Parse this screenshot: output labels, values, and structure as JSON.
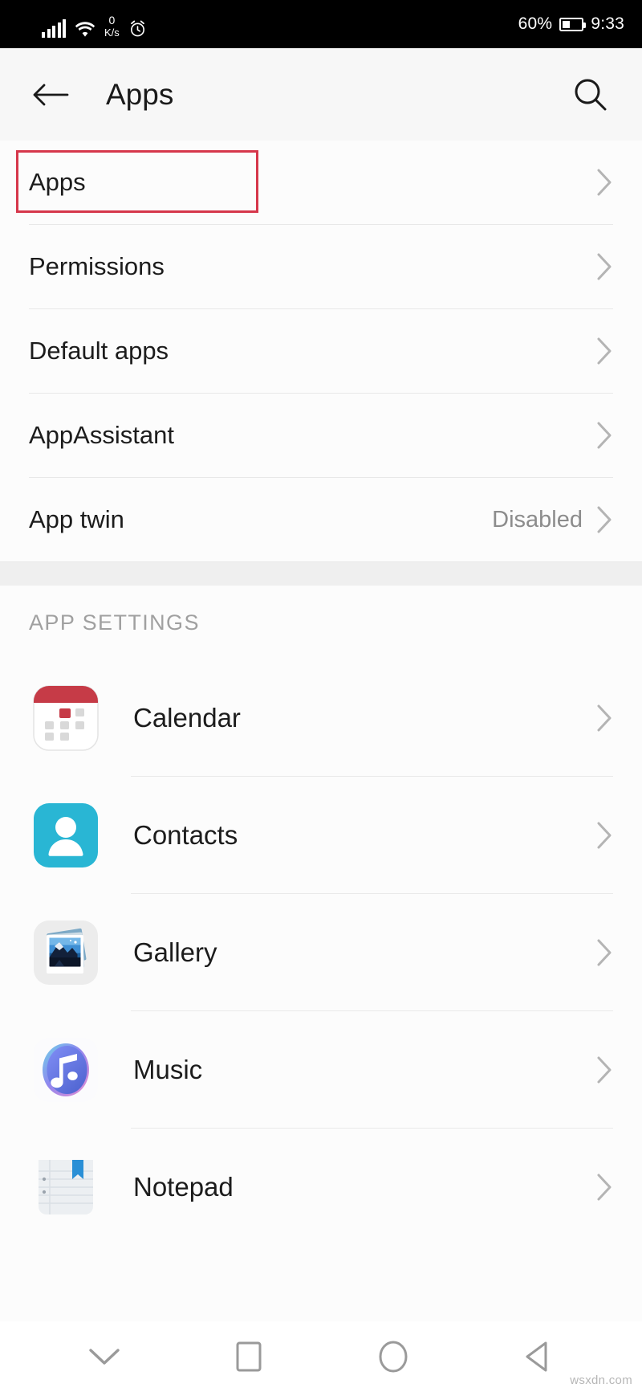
{
  "statusbar": {
    "network_speed_value": "0",
    "network_speed_unit": "K/s",
    "battery_percent": "60%",
    "time": "9:33",
    "icons": [
      "signal-bars-icon",
      "wifi-icon",
      "alarm-clock-icon",
      "battery-icon"
    ]
  },
  "appbar": {
    "back_label": "back-arrow-icon",
    "title": "Apps",
    "search_label": "search-icon"
  },
  "settings_list": [
    {
      "label": "Apps",
      "value": "",
      "highlighted": true
    },
    {
      "label": "Permissions",
      "value": "",
      "highlighted": false
    },
    {
      "label": "Default apps",
      "value": "",
      "highlighted": false
    },
    {
      "label": "AppAssistant",
      "value": "",
      "highlighted": false
    },
    {
      "label": "App twin",
      "value": "Disabled",
      "highlighted": false
    }
  ],
  "app_settings": {
    "header": "APP SETTINGS",
    "apps": [
      {
        "name": "Calendar",
        "icon": "calendar-app-icon"
      },
      {
        "name": "Contacts",
        "icon": "contacts-app-icon"
      },
      {
        "name": "Gallery",
        "icon": "gallery-app-icon"
      },
      {
        "name": "Music",
        "icon": "music-app-icon"
      },
      {
        "name": "Notepad",
        "icon": "notepad-app-icon"
      }
    ]
  },
  "navbar": {
    "items": [
      {
        "name": "hide-keyboard-chevron-icon"
      },
      {
        "name": "recents-square-icon"
      },
      {
        "name": "home-circle-icon"
      },
      {
        "name": "back-triangle-icon"
      }
    ]
  },
  "watermark": "wsxdn.com",
  "colors": {
    "highlight": "#d6374b",
    "statusbar_bg": "#000000",
    "appbar_bg": "#f7f7f7",
    "page_bg": "#fcfcfc",
    "divider": "#e8e8e8",
    "value_text": "#8c8c8c",
    "section_header_text": "#a0a0a0",
    "calendar_red": "#c63b47",
    "contacts_cyan": "#29b6d4",
    "notepad_blue": "#2a8fd6"
  }
}
